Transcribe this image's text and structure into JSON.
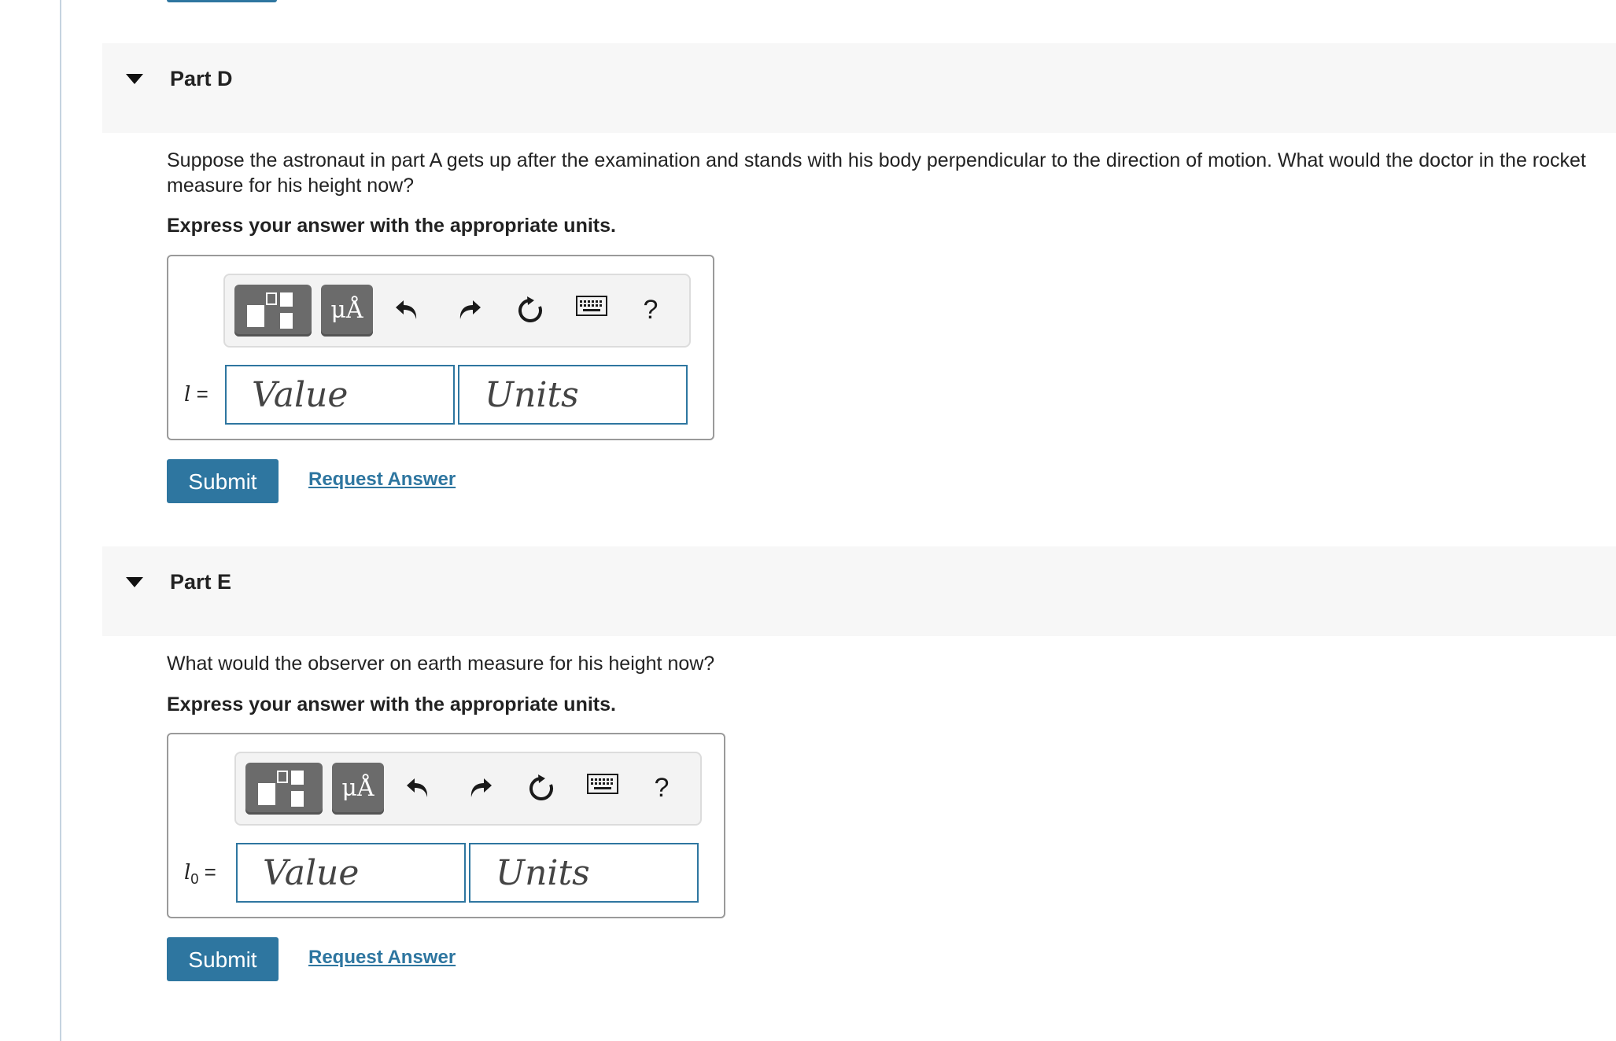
{
  "part_d": {
    "title": "Part D",
    "question": "Suppose the astronaut in part A gets up after the examination and stands with his body perpendicular to the direction of motion. What would the doctor in the rocket measure for his height now?",
    "instruction": "Express your answer with the appropriate units.",
    "variable": "l",
    "equals": "=",
    "value_placeholder": "Value",
    "units_placeholder": "Units",
    "submit_label": "Submit",
    "request_label": "Request Answer"
  },
  "part_e": {
    "title": "Part E",
    "question": "What would the observer on earth measure for his height now?",
    "instruction": "Express your answer with the appropriate units.",
    "variable": "l",
    "subscript": "0",
    "equals": "=",
    "value_placeholder": "Value",
    "units_placeholder": "Units",
    "submit_label": "Submit",
    "request_label": "Request Answer"
  },
  "toolbar": {
    "symbols_label": "μÅ",
    "help_label": "?",
    "icons": [
      "templates-icon",
      "symbols-icon",
      "undo-icon",
      "redo-icon",
      "reset-icon",
      "keyboard-icon",
      "help-icon"
    ]
  },
  "colors": {
    "accent": "#2e76a0",
    "header_bg": "#f7f7f7",
    "toolbar_button": "#6b6b6b"
  }
}
